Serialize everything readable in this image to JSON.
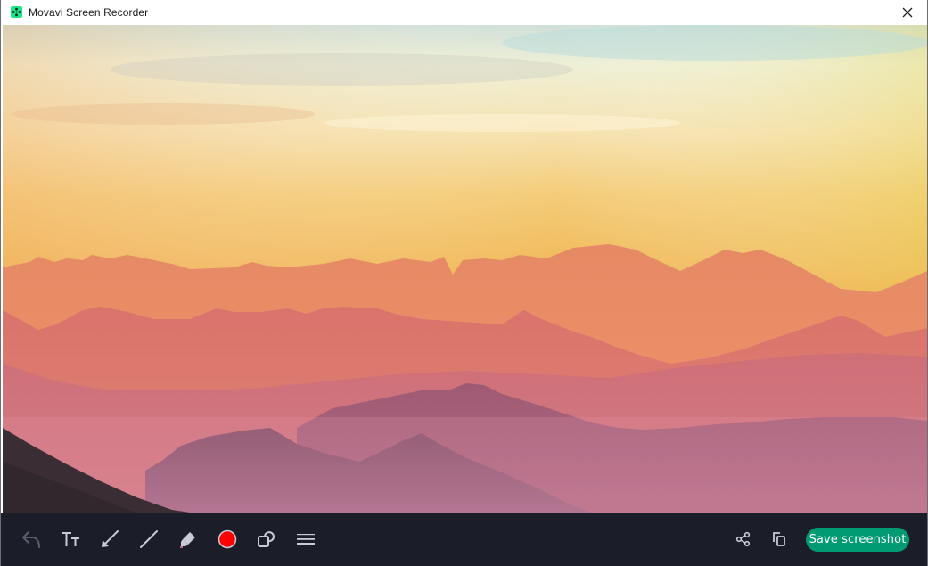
{
  "window": {
    "title": "Movavi Screen Recorder",
    "logo_icon": "movavi-logo-icon",
    "close_icon": "close-icon"
  },
  "canvas": {
    "content": "Screenshot image: layered mountain ridges at sunset with an orange-to-pink haze and a dark foreground slope"
  },
  "toolbar": {
    "tools": [
      {
        "name": "undo",
        "icon": "undo-icon",
        "enabled": false
      },
      {
        "name": "text",
        "icon": "text-icon"
      },
      {
        "name": "arrow",
        "icon": "arrow-icon"
      },
      {
        "name": "line",
        "icon": "line-icon"
      },
      {
        "name": "marker",
        "icon": "marker-icon"
      },
      {
        "name": "color",
        "icon": "color-swatch-icon",
        "value": "#ff0000"
      },
      {
        "name": "shapes",
        "icon": "shapes-icon"
      },
      {
        "name": "line-width",
        "icon": "line-width-icon"
      }
    ],
    "share_icon": "share-icon",
    "copy_icon": "copy-icon",
    "save_label": "Save screenshot"
  },
  "colors": {
    "toolbar_bg": "#1b1d29",
    "accent": "#009a73",
    "selected_color": "#ff0000",
    "icon": "#c8ccd4",
    "icon_disabled": "#5a5e6b"
  }
}
